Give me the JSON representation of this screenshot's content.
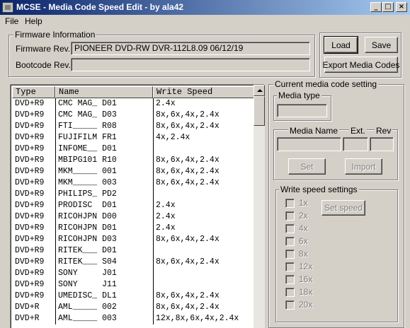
{
  "window": {
    "title": "MCSE - Media Code Speed Edit - by ala42"
  },
  "title_buttons": {
    "minimize": "_",
    "maximize": "□",
    "close": "×"
  },
  "menu": [
    "File",
    "Help"
  ],
  "firmware": {
    "group_label": "Firmware Information",
    "rev_label": "Firmware Rev.",
    "rev_value": "PIONEER DVD-RW  DVR-112L8.09 06/12/19",
    "bootcode_label": "Bootcode Rev.",
    "bootcode_value": ""
  },
  "buttons": {
    "load": "Load",
    "save": "Save",
    "export": "Export Media Codes"
  },
  "table": {
    "columns": [
      "Type",
      "Name",
      "Write Speed"
    ],
    "rows": [
      [
        "DVD+R9",
        "CMC MAG_ D01",
        "2.4x"
      ],
      [
        "DVD+R9",
        "CMC MAG_ D03",
        "8x,6x,4x,2.4x"
      ],
      [
        "DVD+R9",
        "FTI_____ R08",
        "8x,6x,4x,2.4x"
      ],
      [
        "DVD+R9",
        "FUJIFILM FR1",
        "4x,2.4x"
      ],
      [
        "DVD+R9",
        "INFOME__ D01",
        ""
      ],
      [
        "DVD+R9",
        "MBIPG101 R10",
        "8x,6x,4x,2.4x"
      ],
      [
        "DVD+R9",
        "MKM_____ 001",
        "8x,6x,4x,2.4x"
      ],
      [
        "DVD+R9",
        "MKM_____ 003",
        "8x,6x,4x,2.4x"
      ],
      [
        "DVD+R9",
        "PHILIPS_ PD2",
        ""
      ],
      [
        "DVD+R9",
        "PRODISC  D01",
        "2.4x"
      ],
      [
        "DVD+R9",
        "RICOHJPN D00",
        "2.4x"
      ],
      [
        "DVD+R9",
        "RICOHJPN D01",
        "2.4x"
      ],
      [
        "DVD+R9",
        "RICOHJPN D03",
        "8x,6x,4x,2.4x"
      ],
      [
        "DVD+R9",
        "RITEK___ D01",
        ""
      ],
      [
        "DVD+R9",
        "RITEK___ S04",
        "8x,6x,4x,2.4x"
      ],
      [
        "DVD+R9",
        "SONY     J01",
        ""
      ],
      [
        "DVD+R9",
        "SONY     J11",
        ""
      ],
      [
        "DVD+R9",
        "UMEDISC_ DL1",
        "8x,6x,4x,2.4x"
      ],
      [
        "DVD+R",
        "AML_____ 002",
        "8x,6x,4x,2.4x"
      ],
      [
        "DVD+R",
        "AML_____ 003",
        "12x,8x,6x,4x,2.4x"
      ]
    ]
  },
  "current": {
    "group_label": "Current media code setting",
    "media_type_label": "Media type",
    "media_type_value": "",
    "media_name_label": "Media Name",
    "ext_label": "Ext.",
    "rev_label": "Rev",
    "media_name_value": "",
    "ext_value": "",
    "rev_value": "",
    "set_button": "Set",
    "import_button": "Import",
    "write_speed_label": "Write speed settings",
    "set_speed_button": "Set speed",
    "speeds": [
      "1x",
      "2x",
      "4x",
      "6x",
      "8x",
      "12x",
      "16x",
      "18x",
      "20x"
    ]
  }
}
